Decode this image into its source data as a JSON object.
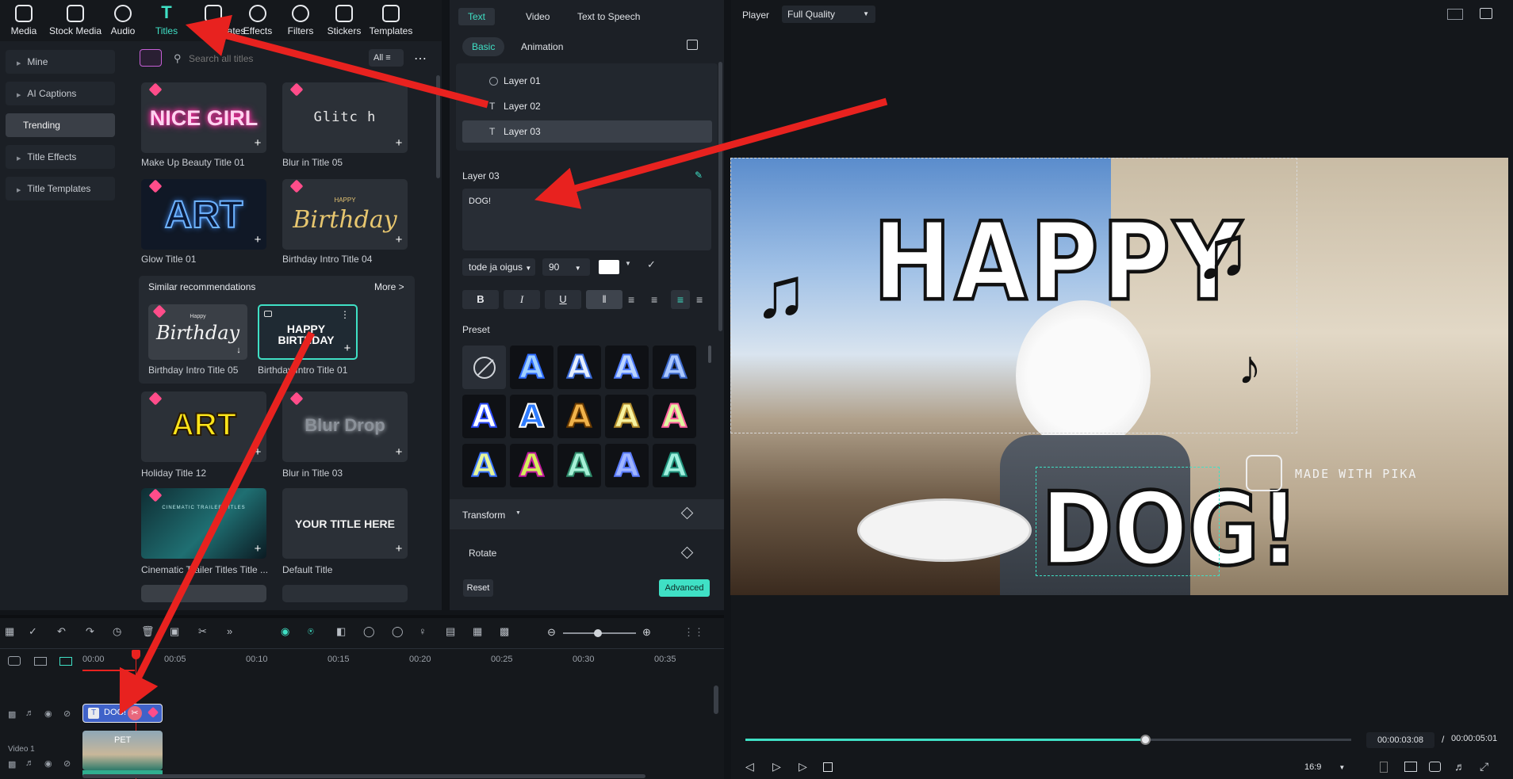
{
  "nav": [
    "Media",
    "Stock Media",
    "Audio",
    "Titles",
    "Templates",
    "Effects",
    "Filters",
    "Stickers",
    "Templates"
  ],
  "nav_hidden_label": "Templates",
  "sidebar": [
    "Mine",
    "AI Captions",
    "Trending",
    "Title Effects",
    "Title Templates"
  ],
  "search": {
    "placeholder": "Search all titles",
    "filter": "All"
  },
  "titles": [
    {
      "name": "Make Up Beauty Title 01",
      "art": "NICE GIRL"
    },
    {
      "name": "Blur in Title 05",
      "art": "Glitc h"
    },
    {
      "name": "Glow Title 01",
      "art": "ART"
    },
    {
      "name": "Birthday Intro Title 04",
      "art": "Birthday",
      "art_small": "HAPPY"
    },
    {
      "name": "Holiday Title 12",
      "art": "ART"
    },
    {
      "name": "Blur in Title 03",
      "art": "Blur Drop"
    },
    {
      "name": "Cinematic Trailer Titles Title ...",
      "art": "CINEMATIC TRAILER TITLES"
    },
    {
      "name": "Default Title",
      "art": "YOUR TITLE HERE"
    }
  ],
  "recommend": {
    "heading": "Similar recommendations",
    "more": "More >",
    "items": [
      {
        "name": "Birthday Intro Title 05",
        "art": "Birthday",
        "art_small": "Happy"
      },
      {
        "name": "Birthday Intro Title 01",
        "art": "HAPPY BIRTHDAY"
      }
    ]
  },
  "props": {
    "tabs": [
      "Text",
      "Video",
      "Text to Speech"
    ],
    "subtabs": [
      "Basic",
      "Animation"
    ],
    "layers": [
      "Layer 01",
      "Layer 02",
      "Layer 03"
    ],
    "current_layer": "Layer 03",
    "text_value": "DOG!",
    "font": "tode ja oigus",
    "size": "90",
    "preset_label": "Preset",
    "transform": "Transform",
    "rotate": "Rotate",
    "reset": "Reset",
    "advanced": "Advanced",
    "format_buttons": [
      "B",
      "I",
      "U"
    ]
  },
  "player": {
    "label": "Player",
    "quality": "Full Quality",
    "overlay_top": "HAPPY",
    "overlay_bottom": "DOG!",
    "watermark": "MADE WITH PIKA",
    "current": "00:00:03:08",
    "separator": "/",
    "total": "00:00:05:01",
    "ratio": "16:9",
    "progress": 0.66
  },
  "timeline": {
    "ticks": [
      "00:00",
      "00:05",
      "00:10",
      "00:15",
      "00:20",
      "00:25",
      "00:30",
      "00:35"
    ],
    "title_clip": "DOG!",
    "video_label": "Video 1",
    "video_clip": "PET"
  },
  "colors": {
    "accent": "#3fe0c5",
    "arrow": "#e8221f",
    "gem": "#ff4d8a"
  }
}
